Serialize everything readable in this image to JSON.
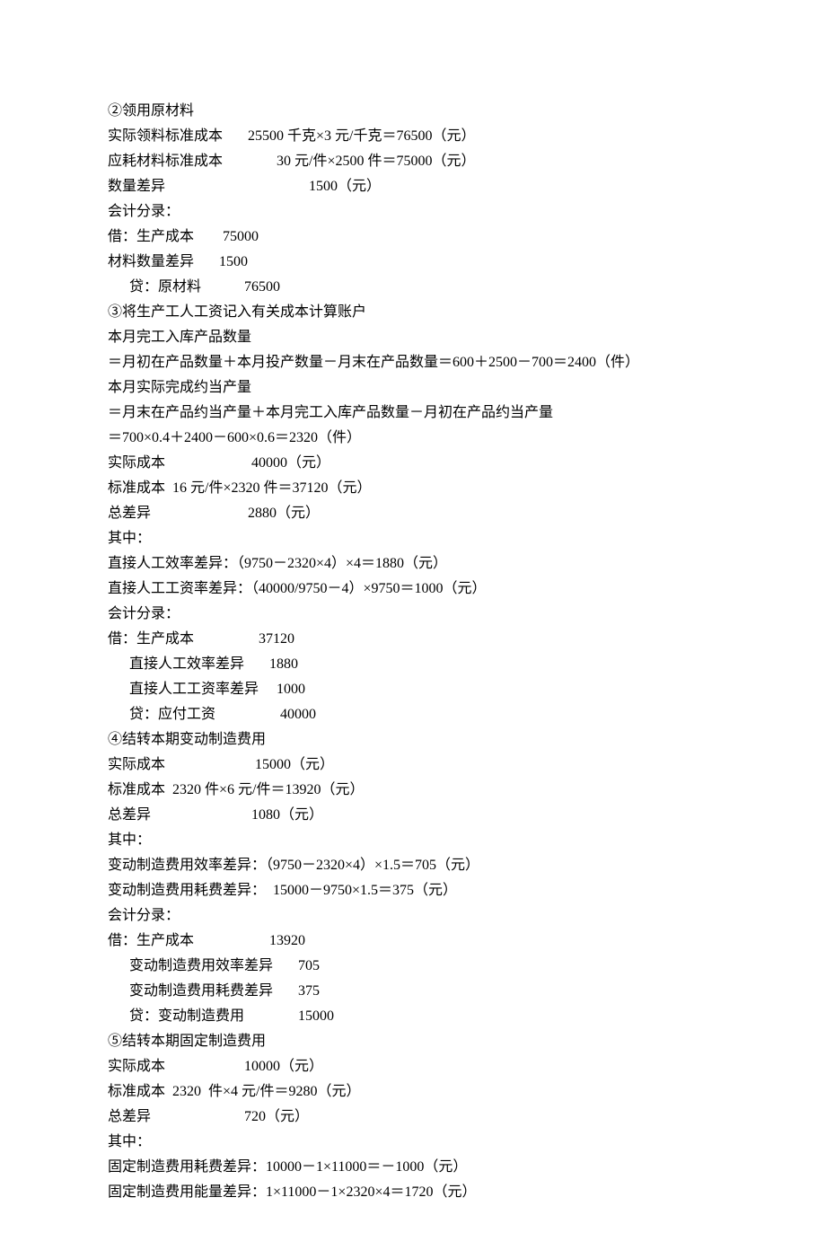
{
  "lines": [
    "②领用原材料",
    "实际领料标准成本       25500 千克×3 元/千克＝76500（元）",
    "应耗材料标准成本               30 元/件×2500 件＝75000（元）",
    "数量差异                                        1500（元）",
    "会计分录：",
    "借：生产成本        75000",
    "材料数量差异       1500",
    "      贷：原材料            76500",
    "③将生产工人工资记入有关成本计算账户",
    "本月完工入库产品数量",
    "＝月初在产品数量＋本月投产数量－月末在产品数量＝600＋2500－700＝2400（件）",
    "本月实际完成约当产量",
    "＝月末在产品约当产量＋本月完工入库产品数量－月初在产品约当产量",
    "＝700×0.4＋2400－600×0.6＝2320（件）",
    "实际成本                        40000（元）",
    "标准成本  16 元/件×2320 件＝37120（元）",
    "总差异                           2880（元）",
    "其中：",
    "直接人工效率差异：（9750－2320×4）×4＝1880（元）",
    "直接人工工资率差异：（40000/9750－4）×9750＝1000（元）",
    "会计分录：",
    "借：生产成本                  37120",
    "      直接人工效率差异       1880",
    "      直接人工工资率差异     1000",
    "      贷：应付工资                  40000",
    "④结转本期变动制造费用",
    "实际成本                         15000（元）",
    "标准成本  2320 件×6 元/件＝13920（元）",
    "总差异                            1080（元）",
    "其中：",
    "变动制造费用效率差异：（9750－2320×4）×1.5＝705（元）",
    "变动制造费用耗费差异：  15000－9750×1.5＝375（元）",
    "会计分录：",
    "借：生产成本                     13920",
    "      变动制造费用效率差异       705",
    "      变动制造费用耗费差异       375",
    "      贷：变动制造费用               15000",
    "⑤结转本期固定制造费用",
    "实际成本                      10000（元）",
    "标准成本  2320  件×4 元/件＝9280（元）",
    "总差异                          720（元）",
    "其中：",
    "固定制造费用耗费差异：10000－1×11000＝－1000（元）",
    "固定制造费用能量差异：1×11000－1×2320×4＝1720（元）"
  ]
}
